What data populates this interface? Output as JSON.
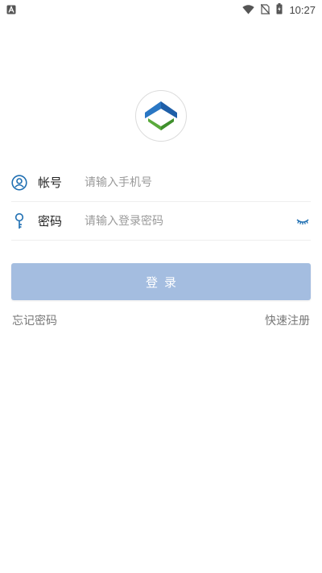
{
  "status_bar": {
    "time": "10:27",
    "notification_icon": "a-icon",
    "icons": [
      "wifi-icon",
      "no-sim-icon",
      "battery-charging-icon"
    ]
  },
  "logo": {
    "icon": "app-logo",
    "colors": {
      "blue": "#1f5fa8",
      "green": "#5aaa3c"
    }
  },
  "form": {
    "account": {
      "label": "帐号",
      "placeholder": "请输入手机号",
      "value": "",
      "icon": "user-icon"
    },
    "password": {
      "label": "密码",
      "placeholder": "请输入登录密码",
      "value": "",
      "icon": "key-icon",
      "toggle_icon": "eye-closed-icon"
    }
  },
  "login_button": {
    "label": "登录",
    "color": "#a4bde0"
  },
  "links": {
    "forgot_password": "忘记密码",
    "register": "快速注册"
  },
  "accent_color": "#1f6fb2"
}
